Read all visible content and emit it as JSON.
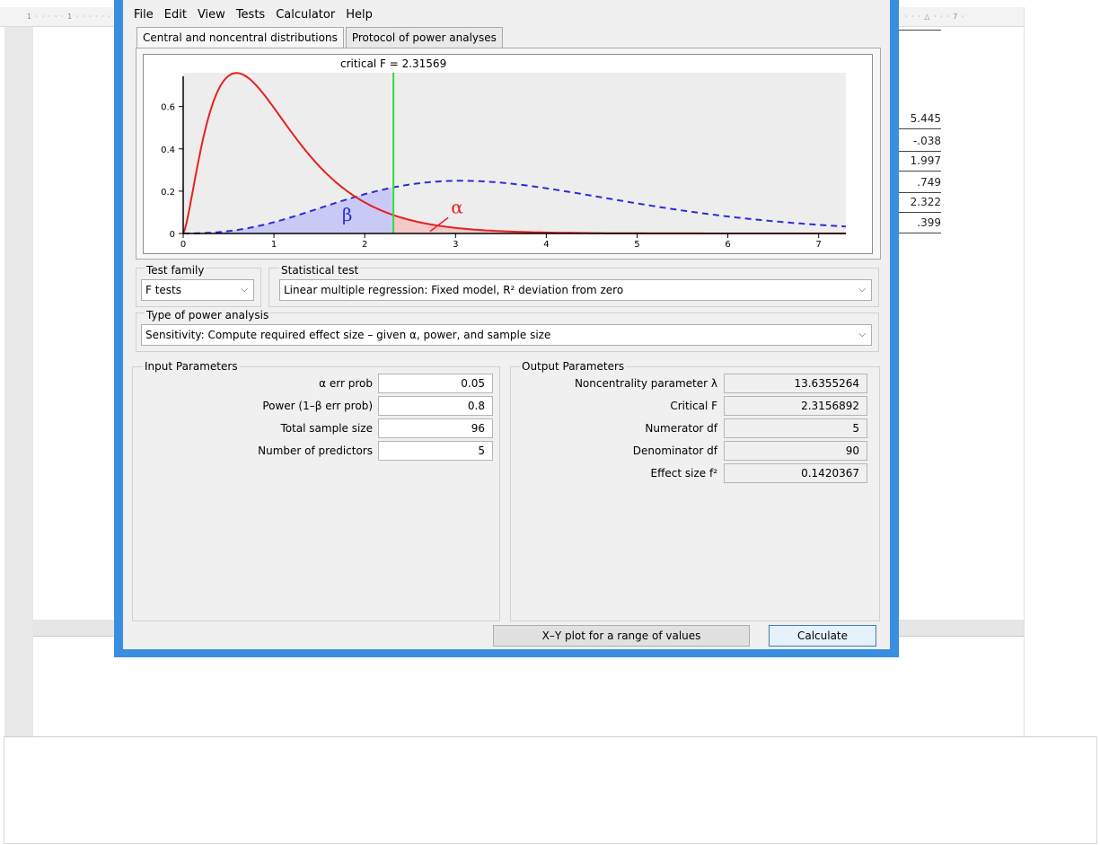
{
  "background_doc": {
    "values": [
      "5.445",
      "-.038",
      "1.997",
      ".749",
      "2.322",
      ".399"
    ]
  },
  "window": {
    "menu": [
      "File",
      "Edit",
      "View",
      "Tests",
      "Calculator",
      "Help"
    ],
    "tabs": [
      "Central and noncentral distributions",
      "Protocol of power analyses"
    ],
    "plot": {
      "critical_label": "critical F = 2.31569",
      "beta_symbol": "β",
      "alpha_symbol": "α"
    },
    "test_family": {
      "label": "Test family",
      "value": "F tests"
    },
    "statistical_test": {
      "label": "Statistical test",
      "value": "Linear multiple regression: Fixed model, R² deviation from zero"
    },
    "power_analysis": {
      "label": "Type of power analysis",
      "value": "Sensitivity: Compute required effect size – given α, power, and sample size"
    },
    "input": {
      "title": "Input Parameters",
      "rows": [
        {
          "label": "α err prob",
          "value": "0.05"
        },
        {
          "label": "Power (1–β err prob)",
          "value": "0.8"
        },
        {
          "label": "Total sample size",
          "value": "96"
        },
        {
          "label": "Number of predictors",
          "value": "5"
        }
      ]
    },
    "output": {
      "title": "Output Parameters",
      "rows": [
        {
          "label": "Noncentrality parameter λ",
          "value": "13.6355264"
        },
        {
          "label": "Critical F",
          "value": "2.3156892"
        },
        {
          "label": "Numerator df",
          "value": "5"
        },
        {
          "label": "Denominator df",
          "value": "90"
        },
        {
          "label": "Effect size f²",
          "value": "0.1420367"
        }
      ]
    },
    "buttons": {
      "xy_plot": "X–Y plot for a range of values",
      "calculate": "Calculate"
    }
  },
  "chart_data": {
    "type": "line",
    "x_ticks": [
      0,
      1,
      2,
      3,
      4,
      5,
      6,
      7
    ],
    "y_ticks": [
      0,
      0.2,
      0.4,
      0.6
    ],
    "xlim": [
      0,
      7.3
    ],
    "ylim": [
      0,
      0.76
    ],
    "critical_f": 2.31569,
    "central": {
      "df1": 5,
      "df2": 90,
      "color": "#e8201e",
      "style": "solid"
    },
    "noncentral": {
      "df1": 5,
      "df2": 90,
      "lambda": 13.6355264,
      "color": "#2b2bd9",
      "style": "dashed"
    },
    "colors": {
      "critical_line": "#33dd44",
      "beta_fill": "#c9c9f5",
      "plot_bg": "#ededed"
    }
  }
}
